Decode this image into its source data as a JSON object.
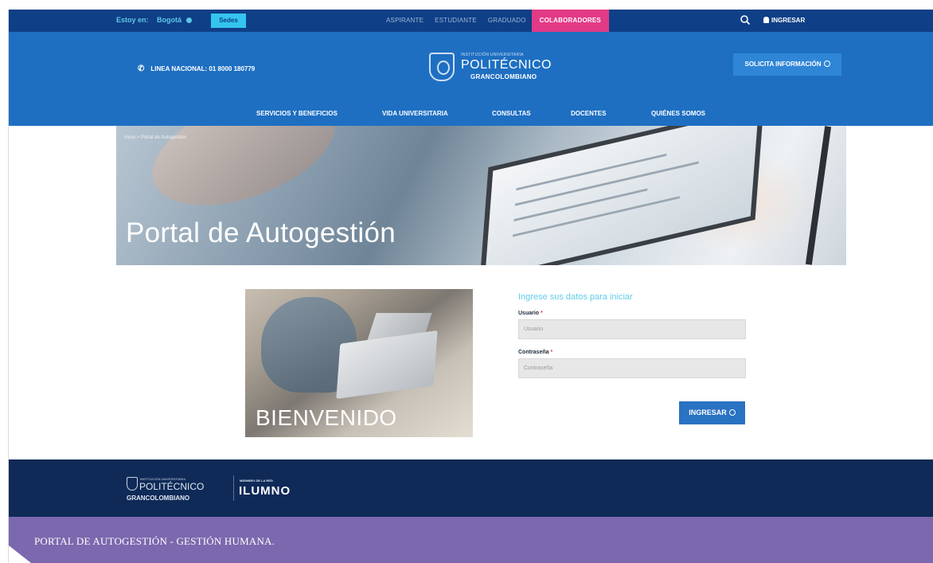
{
  "topbar": {
    "location_prefix": "Estoy en:",
    "location_city": "Bogotá",
    "switch_label": "Sedes",
    "tabs": [
      {
        "label": "ASPIRANTE"
      },
      {
        "label": "ESTUDIANTE"
      },
      {
        "label": "GRADUADO"
      },
      {
        "label": "COLABORADORES"
      }
    ],
    "login_label": "INGRESAR",
    "active_color": "#e23a86"
  },
  "header": {
    "phone": "LINEA NACIONAL: 01 8000 180779",
    "logo_line1": "INSTITUCIÓN UNIVERSITARIA",
    "logo_line2": "POLITÉCNICO",
    "logo_line3": "GRANCOLOMBIANO",
    "solicita": "SOLICITA INFORMACIÓN",
    "nav": [
      {
        "label": "SERVICIOS Y BENEFICIOS"
      },
      {
        "label": "VIDA UNIVERSITARIA"
      },
      {
        "label": "CONSULTAS"
      },
      {
        "label": "DOCENTES"
      },
      {
        "label": "QUIÉNES SOMOS"
      }
    ]
  },
  "hero": {
    "breadcrumb": "Inicio  >  Portal de Autogestión",
    "title": "Portal de Autogestión"
  },
  "welcome": {
    "text": "BIENVENIDO"
  },
  "login_form": {
    "heading": "Ingrese sus datos para iniciar",
    "user_label": "Usuario",
    "user_placeholder": "Usuario",
    "password_label": "Contraseña",
    "password_placeholder": "Contraseña",
    "required_mark": "*",
    "submit_label": "INGRESAR"
  },
  "footer": {
    "logo_line1": "INSTITUCIÓN UNIVERSITARIA",
    "logo_line2": "POLITÉCNICO",
    "logo_line3": "GRANCOLOMBIANO",
    "member_label": "MIEMBRO DE LA RED",
    "network": "ILUMNO"
  },
  "caption": "PORTAL DE AUTOGESTIÓN - GESTIÓN HUMANA.",
  "colors": {
    "topbar": "#0f3f86",
    "header": "#1e6fc2",
    "footer": "#0f2a57",
    "caption": "#7b68ae",
    "button": "#2a72c2",
    "heading_accent": "#5fcbe9"
  }
}
